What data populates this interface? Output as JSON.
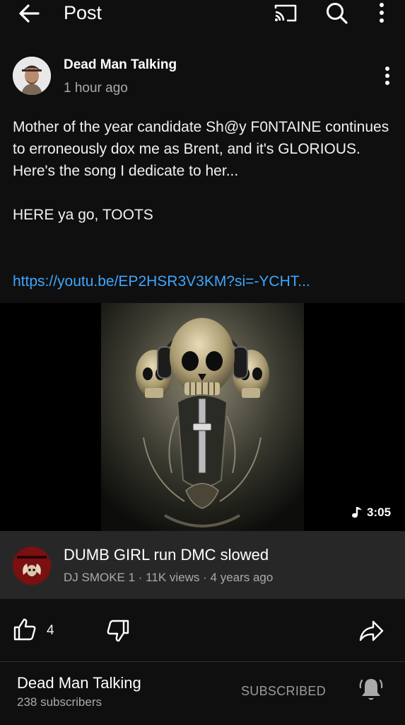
{
  "topbar": {
    "title": "Post",
    "back_icon": "arrow-left-icon",
    "cast_icon": "cast-icon",
    "search_icon": "search-icon",
    "more_icon": "more-vert-icon"
  },
  "post": {
    "author": "Dead Man Talking",
    "time": "1 hour ago",
    "text": "Mother of the year candidate Sh@y F0NTAINE continues to erroneously dox me as Brent, and it's GLORIOUS. Here's the song I dedicate to her...\n\nHERE ya go, TOOTS",
    "link": "https://youtu.be/EP2HSR3V3KM?si=-YCHT..."
  },
  "video": {
    "duration": "3:05",
    "title": "DUMB GIRL run DMC slowed",
    "meta": "DJ SMOKE 1 · 11K views · 4 years ago"
  },
  "actions": {
    "like_count": "4",
    "like_icon": "thumbs-up-icon",
    "dislike_icon": "thumbs-down-icon",
    "share_icon": "share-icon"
  },
  "channel": {
    "name": "Dead Man Talking",
    "subscribers": "238 subscribers",
    "subscribed_label": "SUBSCRIBED",
    "bell_icon": "bell-icon"
  },
  "colors": {
    "background": "#0f0f0f",
    "card": "#272727",
    "link": "#3ea6ff",
    "secondary_text": "#aaaaaa"
  }
}
